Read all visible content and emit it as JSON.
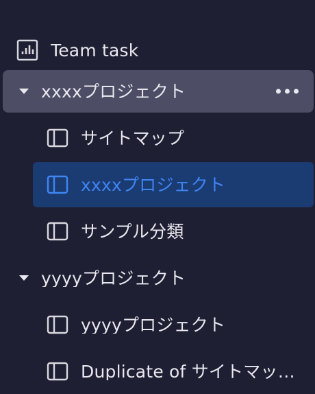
{
  "sidebar": {
    "team_task": {
      "label": "Team task",
      "icon": "bar-chart-icon"
    },
    "groups": [
      {
        "label": "xxxxプロジェクト",
        "expanded": true,
        "selected": true,
        "items": [
          {
            "label": "サイトマップ",
            "icon": "panel-icon",
            "active": false
          },
          {
            "label": "xxxxプロジェクト",
            "icon": "panel-icon",
            "active": true
          },
          {
            "label": "サンプル分類",
            "icon": "panel-icon",
            "active": false
          }
        ]
      },
      {
        "label": "yyyyプロジェクト",
        "expanded": true,
        "selected": false,
        "items": [
          {
            "label": "yyyyプロジェクト",
            "icon": "panel-icon",
            "active": false
          },
          {
            "label": "Duplicate of サイトマッ…",
            "icon": "panel-icon",
            "active": false
          }
        ]
      }
    ]
  },
  "colors": {
    "background": "#1f1f34",
    "selected_group": "#4d4d66",
    "active_item_bg": "#1b3b73",
    "active_item_text": "#3f86f3",
    "text": "#e8e8ee"
  }
}
